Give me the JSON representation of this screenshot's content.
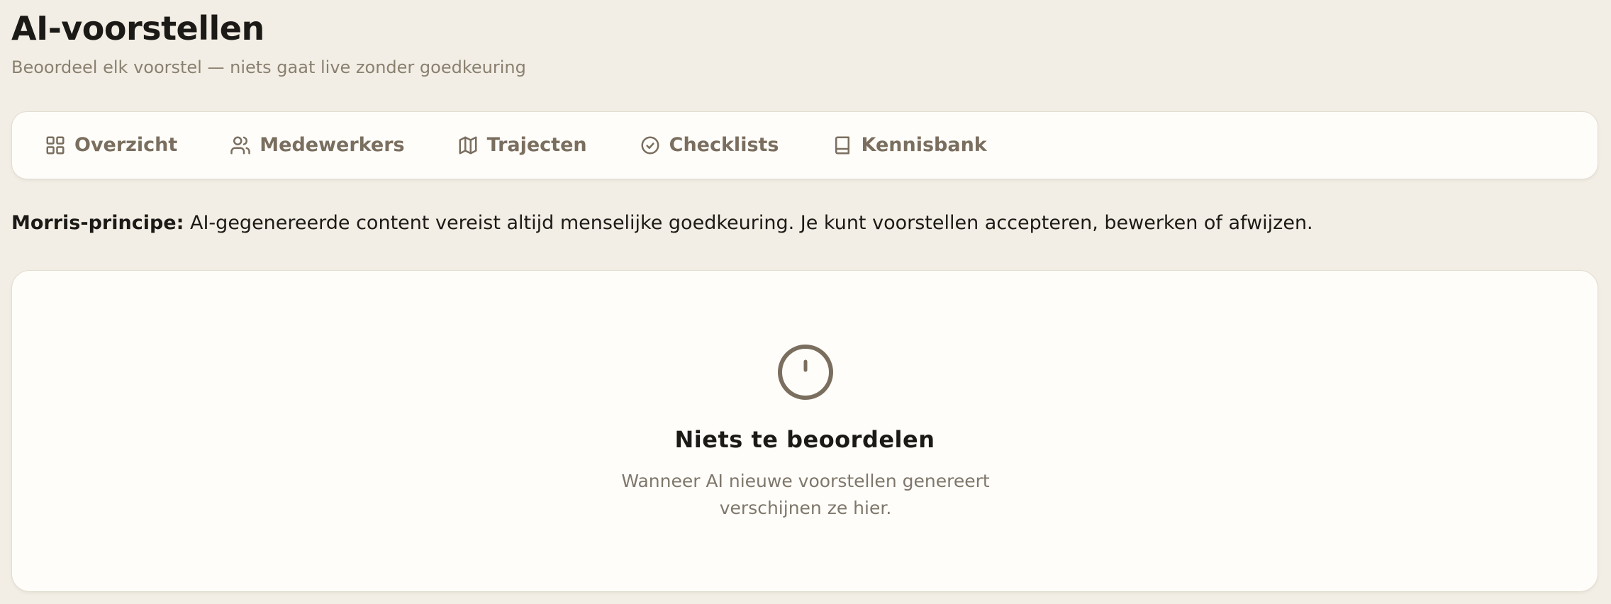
{
  "header": {
    "title": "AI-voorstellen",
    "subtitle": "Beoordeel elk voorstel — niets gaat live zonder goedkeuring"
  },
  "tabs": [
    {
      "label": "Overzicht",
      "icon": "grid-icon"
    },
    {
      "label": "Medewerkers",
      "icon": "users-icon"
    },
    {
      "label": "Trajecten",
      "icon": "map-icon"
    },
    {
      "label": "Checklists",
      "icon": "check-circle-icon"
    },
    {
      "label": "Kennisbank",
      "icon": "book-icon"
    }
  ],
  "notice": {
    "strong": "Morris-principe:",
    "text": "AI-gegenereerde content vereist altijd menselijke goedkeuring. Je kunt voorstellen accepteren, bewerken of afwijzen."
  },
  "empty_state": {
    "icon": "clock-icon",
    "title": "Niets te beoordelen",
    "description": "Wanneer AI nieuwe voorstellen genereert verschijnen ze hier."
  },
  "colors": {
    "background": "#f2eee5",
    "card": "#fefdf9",
    "text": "#1c1a16",
    "muted": "#8a8070",
    "tab_text": "#7a6e5f"
  }
}
